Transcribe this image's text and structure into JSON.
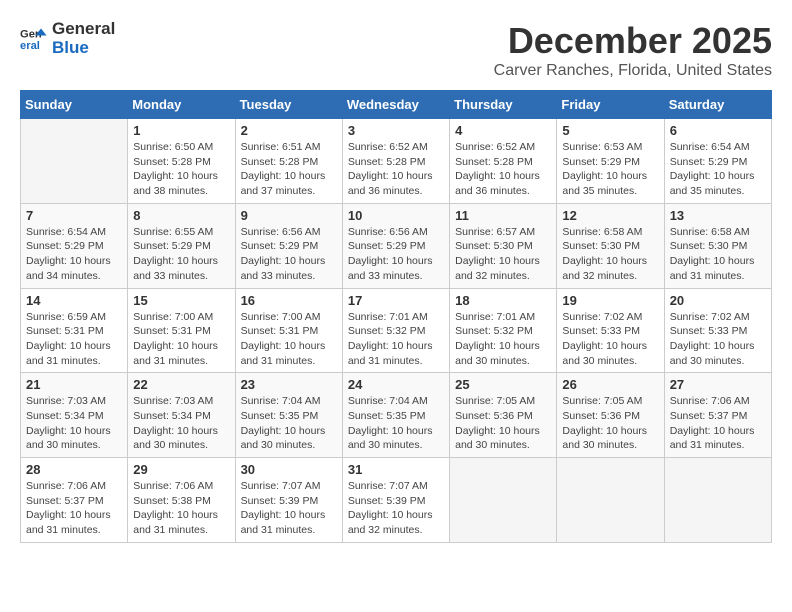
{
  "logo": {
    "line1": "General",
    "line2": "Blue"
  },
  "title": "December 2025",
  "subtitle": "Carver Ranches, Florida, United States",
  "weekdays": [
    "Sunday",
    "Monday",
    "Tuesday",
    "Wednesday",
    "Thursday",
    "Friday",
    "Saturday"
  ],
  "weeks": [
    [
      {
        "day": "",
        "info": ""
      },
      {
        "day": "1",
        "info": "Sunrise: 6:50 AM\nSunset: 5:28 PM\nDaylight: 10 hours\nand 38 minutes."
      },
      {
        "day": "2",
        "info": "Sunrise: 6:51 AM\nSunset: 5:28 PM\nDaylight: 10 hours\nand 37 minutes."
      },
      {
        "day": "3",
        "info": "Sunrise: 6:52 AM\nSunset: 5:28 PM\nDaylight: 10 hours\nand 36 minutes."
      },
      {
        "day": "4",
        "info": "Sunrise: 6:52 AM\nSunset: 5:28 PM\nDaylight: 10 hours\nand 36 minutes."
      },
      {
        "day": "5",
        "info": "Sunrise: 6:53 AM\nSunset: 5:29 PM\nDaylight: 10 hours\nand 35 minutes."
      },
      {
        "day": "6",
        "info": "Sunrise: 6:54 AM\nSunset: 5:29 PM\nDaylight: 10 hours\nand 35 minutes."
      }
    ],
    [
      {
        "day": "7",
        "info": "Sunrise: 6:54 AM\nSunset: 5:29 PM\nDaylight: 10 hours\nand 34 minutes."
      },
      {
        "day": "8",
        "info": "Sunrise: 6:55 AM\nSunset: 5:29 PM\nDaylight: 10 hours\nand 33 minutes."
      },
      {
        "day": "9",
        "info": "Sunrise: 6:56 AM\nSunset: 5:29 PM\nDaylight: 10 hours\nand 33 minutes."
      },
      {
        "day": "10",
        "info": "Sunrise: 6:56 AM\nSunset: 5:29 PM\nDaylight: 10 hours\nand 33 minutes."
      },
      {
        "day": "11",
        "info": "Sunrise: 6:57 AM\nSunset: 5:30 PM\nDaylight: 10 hours\nand 32 minutes."
      },
      {
        "day": "12",
        "info": "Sunrise: 6:58 AM\nSunset: 5:30 PM\nDaylight: 10 hours\nand 32 minutes."
      },
      {
        "day": "13",
        "info": "Sunrise: 6:58 AM\nSunset: 5:30 PM\nDaylight: 10 hours\nand 31 minutes."
      }
    ],
    [
      {
        "day": "14",
        "info": "Sunrise: 6:59 AM\nSunset: 5:31 PM\nDaylight: 10 hours\nand 31 minutes."
      },
      {
        "day": "15",
        "info": "Sunrise: 7:00 AM\nSunset: 5:31 PM\nDaylight: 10 hours\nand 31 minutes."
      },
      {
        "day": "16",
        "info": "Sunrise: 7:00 AM\nSunset: 5:31 PM\nDaylight: 10 hours\nand 31 minutes."
      },
      {
        "day": "17",
        "info": "Sunrise: 7:01 AM\nSunset: 5:32 PM\nDaylight: 10 hours\nand 31 minutes."
      },
      {
        "day": "18",
        "info": "Sunrise: 7:01 AM\nSunset: 5:32 PM\nDaylight: 10 hours\nand 30 minutes."
      },
      {
        "day": "19",
        "info": "Sunrise: 7:02 AM\nSunset: 5:33 PM\nDaylight: 10 hours\nand 30 minutes."
      },
      {
        "day": "20",
        "info": "Sunrise: 7:02 AM\nSunset: 5:33 PM\nDaylight: 10 hours\nand 30 minutes."
      }
    ],
    [
      {
        "day": "21",
        "info": "Sunrise: 7:03 AM\nSunset: 5:34 PM\nDaylight: 10 hours\nand 30 minutes."
      },
      {
        "day": "22",
        "info": "Sunrise: 7:03 AM\nSunset: 5:34 PM\nDaylight: 10 hours\nand 30 minutes."
      },
      {
        "day": "23",
        "info": "Sunrise: 7:04 AM\nSunset: 5:35 PM\nDaylight: 10 hours\nand 30 minutes."
      },
      {
        "day": "24",
        "info": "Sunrise: 7:04 AM\nSunset: 5:35 PM\nDaylight: 10 hours\nand 30 minutes."
      },
      {
        "day": "25",
        "info": "Sunrise: 7:05 AM\nSunset: 5:36 PM\nDaylight: 10 hours\nand 30 minutes."
      },
      {
        "day": "26",
        "info": "Sunrise: 7:05 AM\nSunset: 5:36 PM\nDaylight: 10 hours\nand 30 minutes."
      },
      {
        "day": "27",
        "info": "Sunrise: 7:06 AM\nSunset: 5:37 PM\nDaylight: 10 hours\nand 31 minutes."
      }
    ],
    [
      {
        "day": "28",
        "info": "Sunrise: 7:06 AM\nSunset: 5:37 PM\nDaylight: 10 hours\nand 31 minutes."
      },
      {
        "day": "29",
        "info": "Sunrise: 7:06 AM\nSunset: 5:38 PM\nDaylight: 10 hours\nand 31 minutes."
      },
      {
        "day": "30",
        "info": "Sunrise: 7:07 AM\nSunset: 5:39 PM\nDaylight: 10 hours\nand 31 minutes."
      },
      {
        "day": "31",
        "info": "Sunrise: 7:07 AM\nSunset: 5:39 PM\nDaylight: 10 hours\nand 32 minutes."
      },
      {
        "day": "",
        "info": ""
      },
      {
        "day": "",
        "info": ""
      },
      {
        "day": "",
        "info": ""
      }
    ]
  ]
}
